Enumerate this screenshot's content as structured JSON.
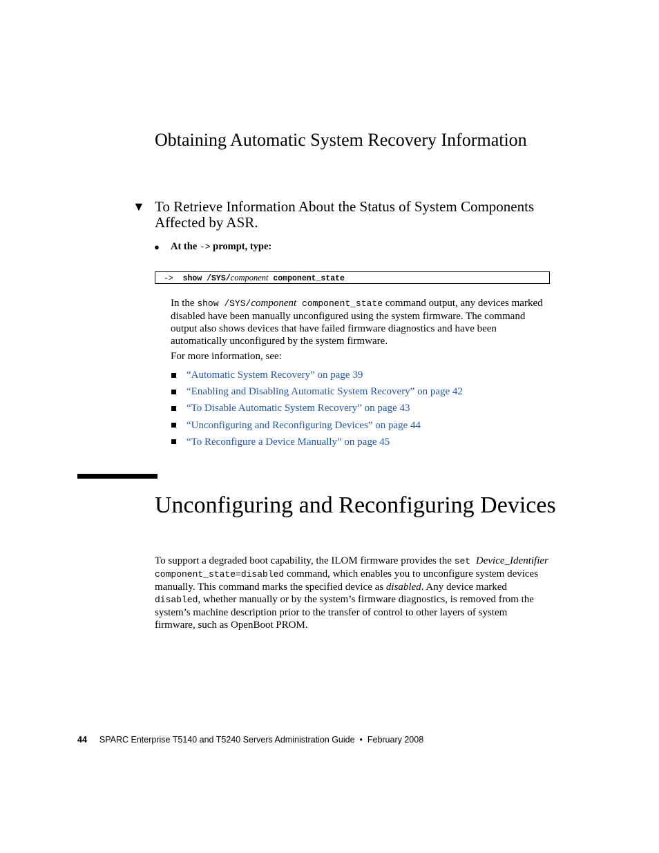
{
  "section_heading": "Obtaining Automatic System Recovery Information",
  "procedure": {
    "marker": "▼",
    "title": "To Retrieve Information About the Status of System Components Affected by ASR."
  },
  "step": {
    "bullet": "●",
    "text_before": "At the ",
    "prompt": "->",
    "text_after": " prompt, type:"
  },
  "code": {
    "prompt": "->",
    "command": "show /SYS/",
    "argument": "component",
    "property": "component_state"
  },
  "para1": {
    "lead": "In the ",
    "cmd": "show /SYS/",
    "arg": "component",
    "prop": " component_state",
    "rest": " command output, any devices marked disabled have been manually unconfigured using the system firmware. The command output also shows devices that have failed firmware diagnostics and have been automatically unconfigured by the system firmware."
  },
  "para2": "For more information, see:",
  "links": [
    {
      "text": "“Automatic System Recovery” on page 39"
    },
    {
      "text": "“Enabling and Disabling Automatic System Recovery” on page 42"
    },
    {
      "text": "“To Disable Automatic System Recovery” on page 43"
    },
    {
      "text": "“Unconfiguring and Reconfiguring Devices” on page 44"
    },
    {
      "text": "“To Reconfigure a Device Manually” on page 45"
    }
  ],
  "link_color": "#2255aa",
  "chapter_heading": "Unconfiguring and Reconfiguring Devices",
  "para3": {
    "lead": "To support a degraded boot capability, the ILOM firmware provides the ",
    "cmd": "set ",
    "arg": "Device_Identifier",
    "prop": " component_state=disabled",
    "mid": " command, which enables you to unconfigure system devices manually. This command marks the specified device as ",
    "em": "disabled",
    "mid2": ". Any device marked ",
    "code2": "disabled",
    "rest": ", whether manually or by the system’s firmware diagnostics, is removed from the system’s machine description prior to the transfer of control to other layers of system firmware, such as OpenBoot PROM."
  },
  "footer": {
    "page_number": "44",
    "title": "SPARC Enterprise T5140 and T5240 Servers Administration Guide",
    "separator": "•",
    "date": "February 2008"
  }
}
